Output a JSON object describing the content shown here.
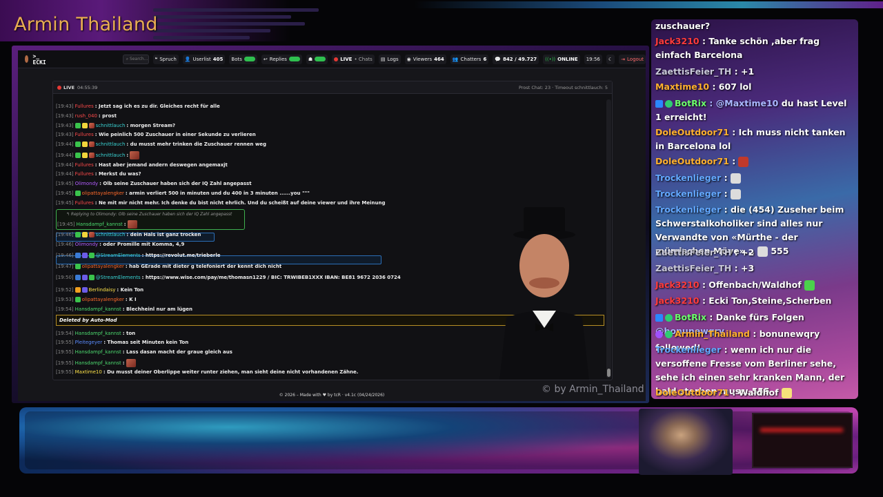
{
  "brand": {
    "title": "Armin Thailand"
  },
  "navbar": {
    "channel": ">_ ECKI",
    "search_placeholder": "Search...",
    "sprueche": "Spruch",
    "userlist": "Userlist",
    "userlist_count": "405",
    "bots": "Bots",
    "replies": "Replies",
    "live": "LIVE",
    "chats": "• Chats",
    "logs": "Logs",
    "viewers": "Viewers",
    "viewers_count": "464",
    "chatters": "Chatters",
    "chatters_count": "6",
    "messages": "842 / 49.727",
    "online": "ONLINE",
    "clock": "19:56",
    "logout": "Logout"
  },
  "panel": {
    "live": "LIVE",
    "uptime": "04:55:39",
    "stats": "Prost Chat: 23 · Timeout schnittlauch: 5"
  },
  "chatlog": [
    {
      "ts": "[19:43]",
      "user": "Fullures",
      "color": "red",
      "msg": ": Jetzt sag ich es zu dir. Gleiches recht für alle"
    },
    {
      "ts": "[19:43]",
      "user": "rush_040",
      "color": "red",
      "msg": ": prost"
    },
    {
      "ts": "[19:43]",
      "user": "schnittlauch",
      "color": "teal",
      "msg": ": morgen Stream?"
    },
    {
      "ts": "[19:43]",
      "user": "Fullures",
      "color": "red",
      "msg": ": Wie peinlich 500 Zuschauer in einer Sekunde zu verlieren"
    },
    {
      "ts": "[19:44]",
      "user": "schnittlauch",
      "color": "teal",
      "msg": ": du musst mehr trinken die Zuschauer rennen weg"
    },
    {
      "ts": "[19:44]",
      "user": "schnittlauch",
      "color": "teal",
      "msg": ":"
    },
    {
      "ts": "[19:44]",
      "user": "Fullures",
      "color": "red",
      "msg": ": Hast aber jemand andern deswegen angemaxjt"
    },
    {
      "ts": "[19:44]",
      "user": "Fullures",
      "color": "red",
      "msg": ": Merkst du was?"
    },
    {
      "ts": "[19:45]",
      "user": "Olimondy",
      "color": "purple",
      "msg": ": Olb seine Zuschauer haben sich der IQ Zahl angepasst"
    },
    {
      "ts": "[19:45]",
      "user": "olipattayalengker",
      "color": "orange",
      "msg": ": armin verliert 500 in minuten und du 400 in 3 minuten ......you \"\"\""
    },
    {
      "ts": "[19:45]",
      "user": "Fullures",
      "color": "red",
      "msg": ": Ne mit mir nicht mehr. Ich denke du bist nicht ehrlich. Und du scheißt auf deine viewer und ihre Meinung"
    },
    {
      "ts": "[19:45]",
      "user": "Hansdampf_kannst",
      "color": "green",
      "msg": ":"
    },
    {
      "ts": "[19:46]",
      "user": "schnittlauch",
      "color": "teal",
      "msg": ": dein Hals ist ganz trocken"
    },
    {
      "ts": "[19:46]",
      "user": "Olimondy",
      "color": "purple",
      "msg": ": oder Promille mit Komma, 4,9"
    },
    {
      "ts": "[19:46]",
      "user": "@StreamElements",
      "color": "teal",
      "msg": ": https://revolut.me/trieberle"
    },
    {
      "ts": "[19:47]",
      "user": "olipattayalengker",
      "color": "orange",
      "msg": ": hab GErade mit dieter g telefoniert der kennt dich nicht"
    },
    {
      "ts": "[19:50]",
      "user": "@StreamElements",
      "color": "teal",
      "msg": ": https://www.wise.com/pay/me/thomasn1229 / BIC: TRWIBEB1XXX IBAN: BE81 9672 2036 0724"
    },
    {
      "ts": "[19:52]",
      "user": "Berlindaisy",
      "color": "yellow",
      "msg": ": Kein Ton"
    },
    {
      "ts": "[19:53]",
      "user": "olipattayalengker",
      "color": "orange",
      "msg": ": K I"
    },
    {
      "ts": "[19:54]",
      "user": "Hansdampf_kannst",
      "color": "green",
      "msg": ": Blechheinl nur am lügen"
    },
    {
      "ts": "[19:54]",
      "user": "Hansdampf_kannst",
      "color": "green",
      "msg": ": ton"
    },
    {
      "ts": "[19:55]",
      "user": "Pleitegeyer",
      "color": "blue",
      "msg": ": Thomas seit Minuten kein Ton"
    },
    {
      "ts": "[19:55]",
      "user": "Hansdampf_kannst",
      "color": "green",
      "msg": ": Lass dasan macht der graue gleich aus"
    },
    {
      "ts": "[19:55]",
      "user": "Hansdampf_kannst",
      "color": "green",
      "msg": ":"
    },
    {
      "ts": "[19:55]",
      "user": "Maxtime10",
      "color": "yellow",
      "msg": ": Du musst deiner Oberlippe weiter runter ziehen, man sieht deine nicht vorhandenen Zähne."
    }
  ],
  "reply": {
    "header": "↰ Replying to Olimondy: Olb seine Zuschauer haben sich der IQ Zahl angepasst"
  },
  "deleted": {
    "label": "Deleted by Auto-Mod"
  },
  "watermark": "© by Armin_Thailand",
  "footer": "© 2026 – Made with ♥ by tcR · v4.1c (04/24/2026)",
  "sidechat": [
    {
      "user": "",
      "msg": "zuschauer?"
    },
    {
      "user": "Jack3210",
      "msg": ": Tanke schön ,aber frag einfach Barcelona"
    },
    {
      "user": "ZaettisFeier_TH",
      "msg": ": +1"
    },
    {
      "user": "Maxtime10",
      "msg": ": 607 lol"
    },
    {
      "user": "BotRix",
      "mention": "@Maxtime10",
      "msg": " du hast Level 1 erreicht!"
    },
    {
      "user": "DoleOutdoor71",
      "msg": ": Ich muss nicht tanken in Barcelona lol"
    },
    {
      "user": "DoleOutdoor71",
      "msg": ":"
    },
    {
      "user": "Trockenlieger",
      "msg": ":"
    },
    {
      "user": "Trockenlieger",
      "msg": ":"
    },
    {
      "user": "Trockenlieger",
      "msg": ": die (454) Zuseher beim Schwerstalkoholiker sind alles nur Verwandte von «Mürthe - der mürrischen Möve»...",
      "suffix": "555"
    },
    {
      "user": "ZaettisFeier_TH",
      "msg": ": +2"
    },
    {
      "user": "ZaettisFeier_TH",
      "msg": ": +3"
    },
    {
      "user": "Jack3210",
      "msg": ": Offenbach/Waldhof"
    },
    {
      "user": "Jack3210",
      "msg": ": Ecki Ton,Steine,Scherben"
    },
    {
      "user": "BotRix",
      "msg": ": Danke fürs Folgen ",
      "mention": "@bonunewqry"
    },
    {
      "user": "Armin_Thailand",
      "msg": ": bonunewqry followed!"
    },
    {
      "user": "Trockenlieger",
      "msg": ": wenn ich nur die versoffene Fresse vom Berliner sehe, sehe ich einen sehr kranken Mann, der bald sterben muss. 555"
    },
    {
      "user": "DoleOutdoor71",
      "msg": ": Waldhof"
    }
  ],
  "colors": {
    "accent_purple": "#5a1a7a",
    "gold": "#e9ad52",
    "live_red": "#e53935",
    "online_green": "#2fbf4f"
  }
}
